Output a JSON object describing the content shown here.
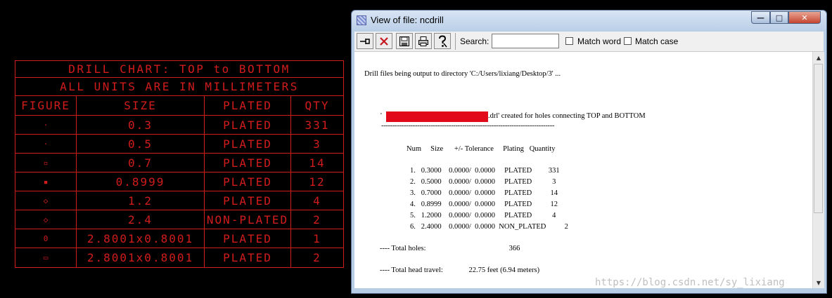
{
  "drill_chart": {
    "title": "DRILL CHART: TOP to BOTTOM",
    "subtitle": "ALL UNITS ARE IN MILLIMETERS",
    "headers": [
      "FIGURE",
      "SIZE",
      "PLATED",
      "QTY"
    ],
    "rows": [
      {
        "figure": "·",
        "size": "0.3",
        "plated": "PLATED",
        "qty": "331"
      },
      {
        "figure": "·",
        "size": "0.5",
        "plated": "PLATED",
        "qty": "3"
      },
      {
        "figure": "▫",
        "size": "0.7",
        "plated": "PLATED",
        "qty": "14"
      },
      {
        "figure": "▪",
        "size": "0.8999",
        "plated": "PLATED",
        "qty": "12"
      },
      {
        "figure": "◇",
        "size": "1.2",
        "plated": "PLATED",
        "qty": "4"
      },
      {
        "figure": "◇",
        "size": "2.4",
        "plated": "NON-PLATED",
        "qty": "2"
      },
      {
        "figure": "0",
        "size": "2.8001x0.8001",
        "plated": "PLATED",
        "qty": "1"
      },
      {
        "figure": "▭",
        "size": "2.8001x0.8001",
        "plated": "PLATED",
        "qty": "2"
      }
    ],
    "color": "#d21c1c"
  },
  "window": {
    "title": "View of file: ncdrill",
    "toolbar": {
      "icons": [
        "pin-icon",
        "close-x-icon",
        "save-icon",
        "print-icon",
        "help-icon"
      ],
      "search_label": "Search:",
      "search_value": "",
      "match_word_label": "Match word",
      "match_case_label": "Match case"
    },
    "content": {
      "intro": "Drill files being output to directory 'C:/Users/lixiang/Desktop/3' ...",
      "file_prefix": "'",
      "file_suffix": ".drl' created for holes connecting TOP and BOTTOM",
      "separator": "-----------------------------------------------------------------------------",
      "headers": "Num     Size      +/- Tolerance     Plating   Quantity",
      "rows": [
        "1.   0.3000    0.0000/  0.0000     PLATED         331",
        "2.   0.5000    0.0000/  0.0000     PLATED           3",
        "3.   0.7000    0.0000/  0.0000     PLATED          14",
        "4.   0.8999    0.0000/  0.0000     PLATED          12",
        "5.   1.2000    0.0000/  0.0000     PLATED           4",
        "6.   2.4000    0.0000/  0.0000  NON_PLATED          2"
      ],
      "total_holes": "---- Total holes:                                             366",
      "total_travel": "---- Total head travel:              22.75 feet (6.94 meters)"
    },
    "redaction_color": "#e2091b"
  },
  "watermark": "https://blog.csdn.net/sy_lixiang"
}
